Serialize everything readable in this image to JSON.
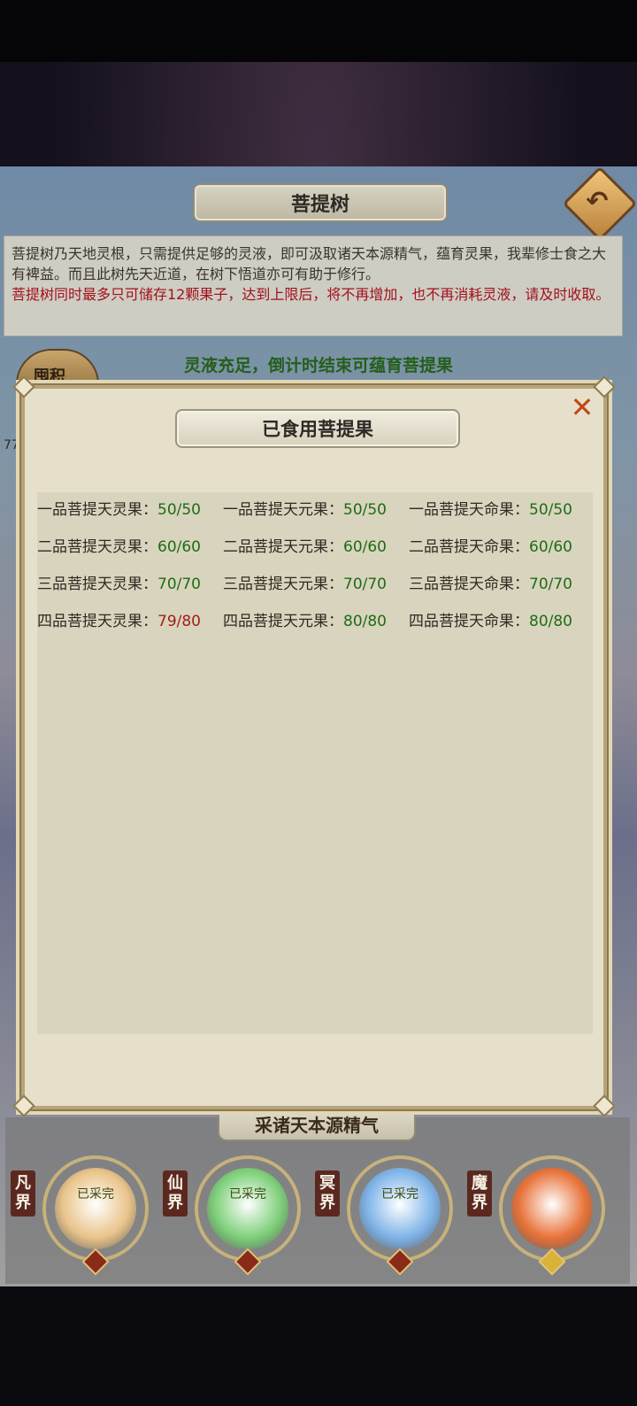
{
  "page": {
    "title": "菩提树",
    "description_normal": "菩提树乃天地灵根，只需提供足够的灵液，即可汲取诸天本源精气，蕴育灵果，我辈修士食之大有裨益。而且此树先天近道，在树下悟道亦可有助于修行。",
    "description_warning": "菩提树同时最多只可储存12颗果子，达到上限后，将不再增加，也不再消耗灵液，请及时收取。",
    "liquid_status": "灵液充足，倒计时结束可蕴育菩提果",
    "accumulate_label": "囤积",
    "side_value": "77",
    "harvest_label": "采诸天本源精气",
    "realms": [
      {
        "name": "凡界",
        "status": "已采完",
        "orb_color": "#e9c48a",
        "gem_color": "#8a2b1a"
      },
      {
        "name": "仙界",
        "status": "已采完",
        "orb_color": "#7ed07a",
        "gem_color": "#8a2b1a"
      },
      {
        "name": "冥界",
        "status": "已采完",
        "orb_color": "#7fb4e8",
        "gem_color": "#8a2b1a"
      },
      {
        "name": "魔界",
        "status": "",
        "orb_color": "#e8733a",
        "gem_color": "#d9b23a"
      }
    ]
  },
  "modal": {
    "title": "已食用菩提果",
    "close_icon": "close-icon",
    "rows": [
      [
        {
          "name": "一品菩提天灵果：",
          "value": "50/50",
          "full": true
        },
        {
          "name": "一品菩提天元果：",
          "value": "50/50",
          "full": true
        },
        {
          "name": "一品菩提天命果：",
          "value": "50/50",
          "full": true
        }
      ],
      [
        {
          "name": "二品菩提天灵果：",
          "value": "60/60",
          "full": true
        },
        {
          "name": "二品菩提天元果：",
          "value": "60/60",
          "full": true
        },
        {
          "name": "二品菩提天命果：",
          "value": "60/60",
          "full": true
        }
      ],
      [
        {
          "name": "三品菩提天灵果：",
          "value": "70/70",
          "full": true
        },
        {
          "name": "三品菩提天元果：",
          "value": "70/70",
          "full": true
        },
        {
          "name": "三品菩提天命果：",
          "value": "70/70",
          "full": true
        }
      ],
      [
        {
          "name": "四品菩提天灵果：",
          "value": "79/80",
          "full": false
        },
        {
          "name": "四品菩提天元果：",
          "value": "80/80",
          "full": true
        },
        {
          "name": "四品菩提天命果：",
          "value": "80/80",
          "full": true
        }
      ]
    ]
  },
  "colors": {
    "value_full": "#1d6d16",
    "value_incomplete": "#a02018",
    "warning_text": "#a3101d",
    "status_green": "#255e1b"
  }
}
